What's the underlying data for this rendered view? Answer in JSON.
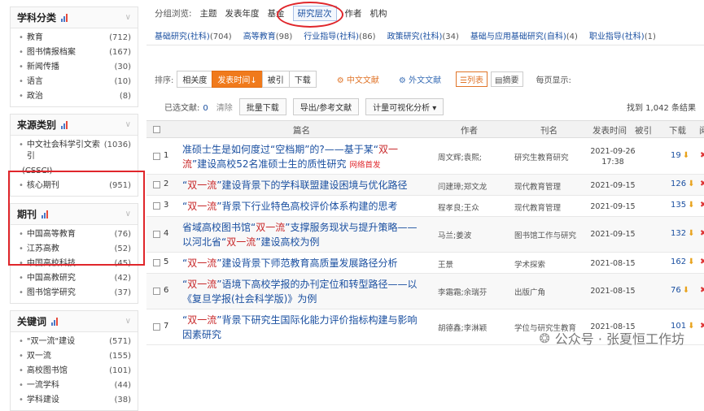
{
  "sidebar": {
    "subjects": {
      "title": "学科分类",
      "items": [
        {
          "label": "教育",
          "count": "(712)"
        },
        {
          "label": "图书情报档案",
          "count": "(167)"
        },
        {
          "label": "新闻传播",
          "count": "(30)"
        },
        {
          "label": "语言",
          "count": "(10)"
        },
        {
          "label": "政治",
          "count": "(8)"
        }
      ]
    },
    "sources": {
      "title": "来源类别",
      "items": [
        {
          "label": "中文社会科学引文索引",
          "count": "(1036)"
        },
        {
          "label": "(CSSCI)",
          "count": ""
        },
        {
          "label": "核心期刊",
          "count": "(951)"
        }
      ]
    },
    "journals": {
      "title": "期刊",
      "items": [
        {
          "label": "中国高等教育",
          "count": "(76)"
        },
        {
          "label": "江苏高教",
          "count": "(52)"
        },
        {
          "label": "中国高校科技",
          "count": "(45)"
        },
        {
          "label": "中国高教研究",
          "count": "(42)"
        },
        {
          "label": "图书馆学研究",
          "count": "(37)"
        }
      ]
    },
    "keywords": {
      "title": "关键词",
      "items": [
        {
          "label": "\"双一流\"建设",
          "count": "(571)"
        },
        {
          "label": "双一流",
          "count": "(155)"
        },
        {
          "label": "高校图书馆",
          "count": "(101)"
        },
        {
          "label": "一流学科",
          "count": "(44)"
        },
        {
          "label": "学科建设",
          "count": "(38)"
        }
      ]
    }
  },
  "nav": {
    "lead": "分组浏览:",
    "tabs": [
      "主题",
      "发表年度",
      "基金",
      "研究层次",
      "作者",
      "机构"
    ]
  },
  "categories": [
    {
      "label": "基础研究(社科)",
      "count": "(704)"
    },
    {
      "label": "高等教育",
      "count": "(98)"
    },
    {
      "label": "行业指导(社科)",
      "count": "(86)"
    },
    {
      "label": "政策研究(社科)",
      "count": "(34)"
    },
    {
      "label": "基础与应用基础研究(自科)",
      "count": "(4)"
    },
    {
      "label": "职业指导(社科)",
      "count": "(1)"
    }
  ],
  "toolbar": {
    "sort_label": "排序:",
    "sorts": [
      "相关度",
      "发表时间↓",
      "被引",
      "下载"
    ],
    "zh": "中文文献",
    "en": "外文文献",
    "list": "列表",
    "abstract": "摘要",
    "per_page": "每页显示:"
  },
  "actions": {
    "selected_label": "已选文献:",
    "selected_count": "0",
    "clear": "清除",
    "batch": "批量下载",
    "export": "导出/参考文献",
    "analyze": "计量可视化分析 ▾",
    "found": "找到 1,042 条结果"
  },
  "table_header": {
    "title": "篇名",
    "author": "作者",
    "journal": "刊名",
    "date": "发表时间",
    "cited": "被引",
    "downloads": "下载",
    "read": "阅"
  },
  "rows": [
    {
      "num": "1",
      "pre": "准硕士生是如何度过“空档期”的?——基于某“",
      "hl1": "双一流",
      "mid": "”建设高校52名准硕士生的质性研究",
      "hl2": "",
      "post": "",
      "tag": "网络首发",
      "author": "周文辉;袁熙;",
      "journal": "研究生教育研究",
      "date": "2021-09-26",
      "time": "17:38",
      "dl": "19"
    },
    {
      "num": "2",
      "pre": "“",
      "hl1": "双一流",
      "mid": "”建设背景下的学科联盟建设困境与优化路径",
      "hl2": "",
      "post": "",
      "tag": "",
      "author": "闫建璋;郑文龙",
      "journal": "现代教育管理",
      "date": "2021-09-15",
      "time": "",
      "dl": "126"
    },
    {
      "num": "3",
      "pre": "“",
      "hl1": "双一流",
      "mid": "”背景下行业特色高校评价体系构建的思考",
      "hl2": "",
      "post": "",
      "tag": "",
      "author": "程孝良;王众",
      "journal": "现代教育管理",
      "date": "2021-09-15",
      "time": "",
      "dl": "135"
    },
    {
      "num": "4",
      "pre": "省域高校图书馆“",
      "hl1": "双一流",
      "mid": "”支撑服务现状与提升策略——以河北省“",
      "hl2": "双一流",
      "post": "”建设高校为例",
      "tag": "",
      "author": "马兰;姜波",
      "journal": "图书馆工作与研究",
      "date": "2021-09-15",
      "time": "",
      "dl": "132"
    },
    {
      "num": "5",
      "pre": "“",
      "hl1": "双一流",
      "mid": "”建设背景下师范教育高质量发展路径分析",
      "hl2": "",
      "post": "",
      "tag": "",
      "author": "王景",
      "journal": "学术探索",
      "date": "2021-08-15",
      "time": "",
      "dl": "162"
    },
    {
      "num": "6",
      "pre": "“",
      "hl1": "双一流",
      "mid": "”语境下高校学报的办刊定位和转型路径——以《复旦学报(社会科学版)》为例",
      "hl2": "",
      "post": "",
      "tag": "",
      "author": "李霜霜;余瑞芬",
      "journal": "出版广角",
      "date": "2021-08-15",
      "time": "",
      "dl": "76"
    },
    {
      "num": "7",
      "pre": "“",
      "hl1": "双一流",
      "mid": "”背景下研究生国际化能力评价指标构建与影响因素研究",
      "hl2": "",
      "post": "",
      "tag": "",
      "author": "胡德鑫;李淋颖",
      "journal": "学位与研究生教育",
      "date": "2021-08-15",
      "time": "",
      "dl": "101"
    }
  ],
  "watermark": "公众号 · 张夏恒工作坊"
}
